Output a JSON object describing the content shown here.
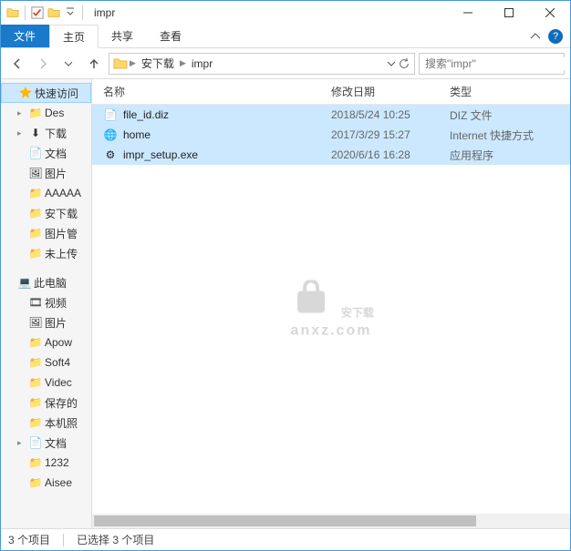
{
  "window": {
    "title": "impr"
  },
  "tabs": {
    "file": "文件",
    "home": "主页",
    "share": "共享",
    "view": "查看"
  },
  "breadcrumb": [
    "安下载",
    "impr"
  ],
  "search": {
    "placeholder": "搜索\"impr\""
  },
  "columns": {
    "name": "名称",
    "date": "修改日期",
    "type": "类型"
  },
  "sidebar": {
    "quick": "快速访问",
    "items": [
      "Des",
      "下载",
      "文档",
      "图片",
      "AAAAA",
      "安下载",
      "图片管",
      "未上传"
    ],
    "thispc": "此电脑",
    "pcitems": [
      "视频",
      "图片",
      "Apow",
      "Soft4",
      "Videc",
      "保存的",
      "本机照",
      "文档",
      "1232",
      "Aisee"
    ]
  },
  "files": [
    {
      "name": "file_id.diz",
      "date": "2018/5/24 10:25",
      "type": "DIZ 文件",
      "icon": "file"
    },
    {
      "name": "home",
      "date": "2017/3/29 15:27",
      "type": "Internet 快捷方式",
      "icon": "url"
    },
    {
      "name": "impr_setup.exe",
      "date": "2020/6/16 16:28",
      "type": "应用程序",
      "icon": "exe"
    }
  ],
  "status": {
    "count": "3 个项目",
    "selected": "已选择 3 个项目"
  },
  "watermark": {
    "main": "安下载",
    "sub": "anxz.com"
  }
}
